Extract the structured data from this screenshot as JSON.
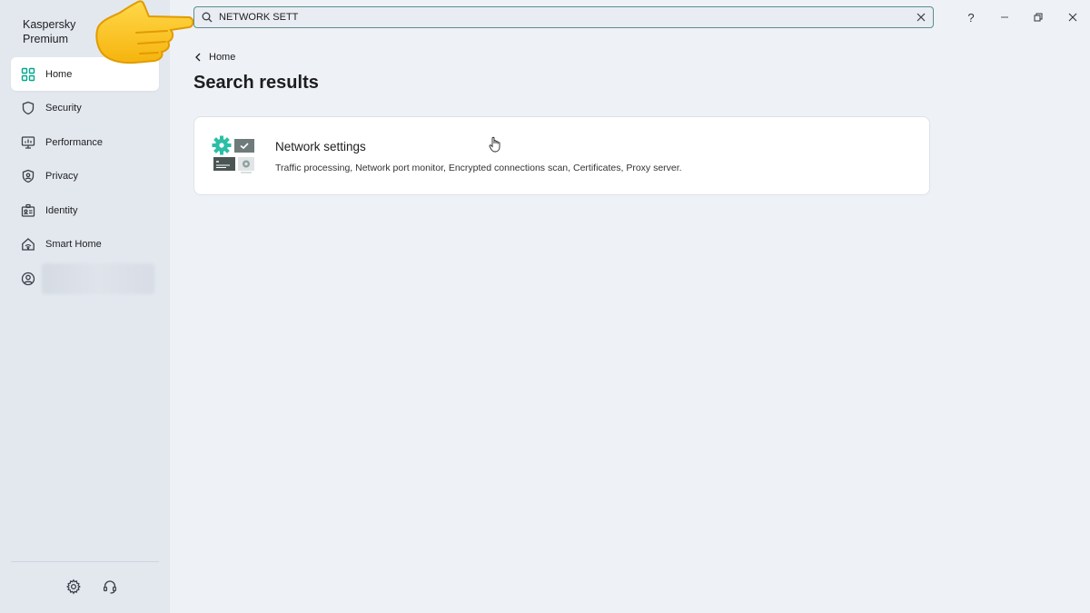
{
  "app": {
    "title_line1": "Kaspersky",
    "title_line2": "Premium"
  },
  "sidebar": {
    "items": [
      {
        "label": "Home",
        "icon": "grid-icon",
        "active": true
      },
      {
        "label": "Security",
        "icon": "shield-icon"
      },
      {
        "label": "Performance",
        "icon": "monitor-icon"
      },
      {
        "label": "Privacy",
        "icon": "privacy-shield-icon"
      },
      {
        "label": "Identity",
        "icon": "id-card-icon"
      },
      {
        "label": "Smart Home",
        "icon": "smart-home-icon"
      }
    ],
    "bottom_icons": [
      "gear-icon",
      "headset-icon"
    ]
  },
  "search": {
    "value": "NETWORK SETT"
  },
  "window_controls": {
    "help": "?"
  },
  "breadcrumb": {
    "back_label": "Home"
  },
  "page": {
    "title": "Search results"
  },
  "results": [
    {
      "title": "Network settings",
      "description": "Traffic processing, Network port monitor, Encrypted connections scan, Certificates, Proxy server."
    }
  ],
  "colors": {
    "accent": "#00a88e",
    "search_border": "#5a8f8a",
    "background": "#eef1f6",
    "sidebar": "#e3e8ef"
  }
}
